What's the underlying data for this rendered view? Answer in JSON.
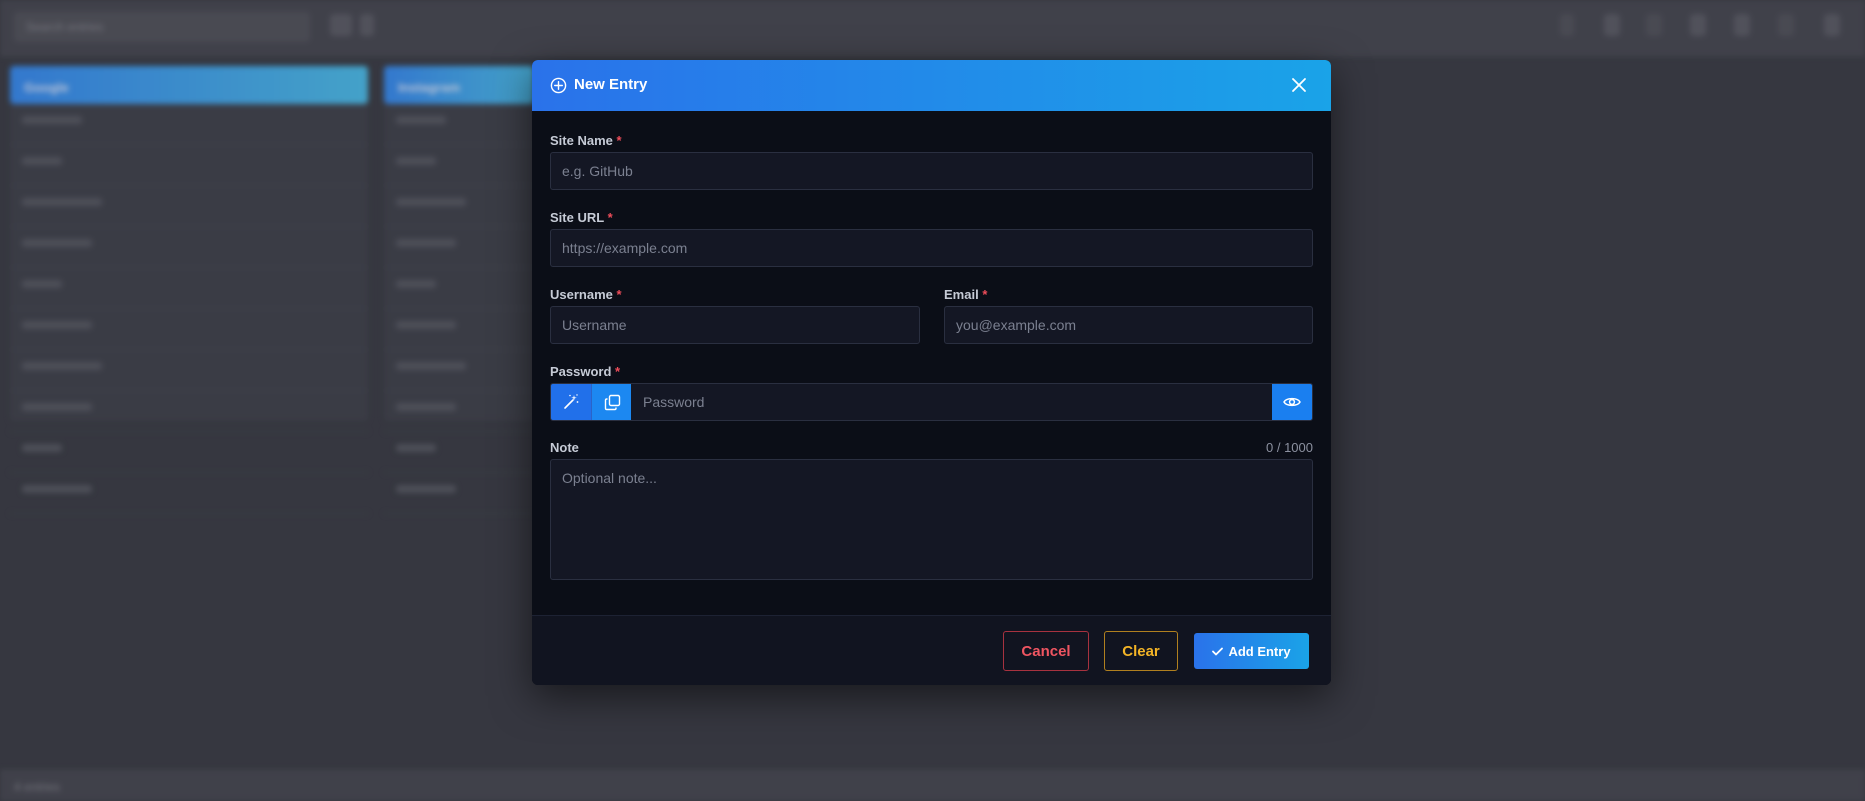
{
  "background": {
    "search_placeholder": "Search entries",
    "columns": [
      {
        "title": "Google"
      },
      {
        "title": "Instagram"
      }
    ],
    "status_text": "4 entries"
  },
  "modal": {
    "title": "New Entry",
    "fields": {
      "site_name": {
        "label": "Site Name",
        "placeholder": "e.g. GitHub",
        "required_mark": "*"
      },
      "site_url": {
        "label": "Site URL",
        "placeholder": "https://example.com",
        "required_mark": "*"
      },
      "username": {
        "label": "Username",
        "placeholder": "Username",
        "required_mark": "*"
      },
      "email": {
        "label": "Email",
        "placeholder": "you@example.com",
        "required_mark": "*"
      },
      "password": {
        "label": "Password",
        "placeholder": "Password",
        "required_mark": "*"
      },
      "note": {
        "label": "Note",
        "placeholder": "Optional note...",
        "counter": "0 / 1000"
      }
    },
    "footer": {
      "cancel_label": "Cancel",
      "clear_label": "Clear",
      "add_label": "Add Entry"
    }
  },
  "colors": {
    "accent": "#2a72ea",
    "accent_end": "#1aa3e8",
    "danger": "#ef5561",
    "warning": "#f3b426",
    "required": "#ef4d5a"
  },
  "icons": {
    "header": "plus-circle-icon",
    "close": "close-icon",
    "generate": "magic-wand-icon",
    "copy": "copy-icon",
    "reveal": "eye-icon",
    "confirm": "check-icon"
  }
}
